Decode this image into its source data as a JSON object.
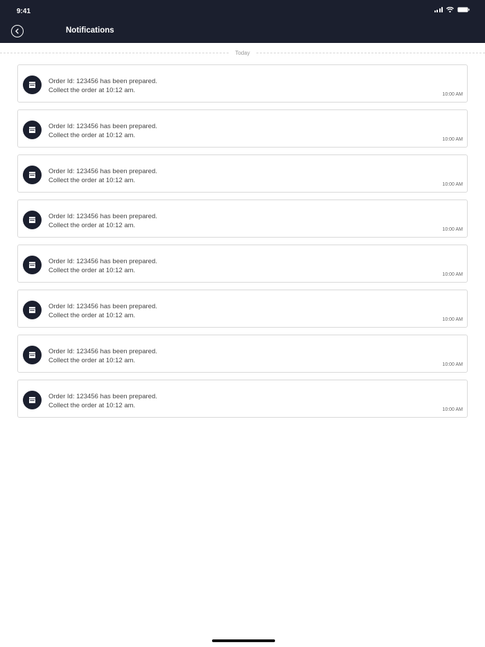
{
  "status_bar": {
    "time": "9:41"
  },
  "header": {
    "title": "Notifications"
  },
  "divider": {
    "label": "Today"
  },
  "notifications": [
    {
      "line1": "Order Id: 123456 has been prepared.",
      "line2": "Collect the order at 10:12 am.",
      "time": "10:00 AM"
    },
    {
      "line1": "Order Id: 123456 has been prepared.",
      "line2": "Collect the order at 10:12 am.",
      "time": "10:00 AM"
    },
    {
      "line1": "Order Id: 123456 has been prepared.",
      "line2": "Collect the order at 10:12 am.",
      "time": "10:00 AM"
    },
    {
      "line1": "Order Id: 123456 has been prepared.",
      "line2": "Collect the order at 10:12 am.",
      "time": "10:00 AM"
    },
    {
      "line1": "Order Id: 123456 has been prepared.",
      "line2": "Collect the order at 10:12 am.",
      "time": "10:00 AM"
    },
    {
      "line1": "Order Id: 123456 has been prepared.",
      "line2": "Collect the order at 10:12 am.",
      "time": "10:00 AM"
    },
    {
      "line1": "Order Id: 123456 has been prepared.",
      "line2": "Collect the order at 10:12 am.",
      "time": "10:00 AM"
    },
    {
      "line1": "Order Id: 123456 has been prepared.",
      "line2": "Collect the order at 10:12 am.",
      "time": "10:00 AM"
    }
  ],
  "icons": {
    "back": "back-arrow-icon",
    "notification": "store-icon",
    "signal": "cellular-signal-icon",
    "wifi": "wifi-icon",
    "battery": "battery-icon"
  },
  "colors": {
    "header_bg": "#1b1f2e",
    "card_border": "#d9d9d9",
    "text": "#444444"
  }
}
